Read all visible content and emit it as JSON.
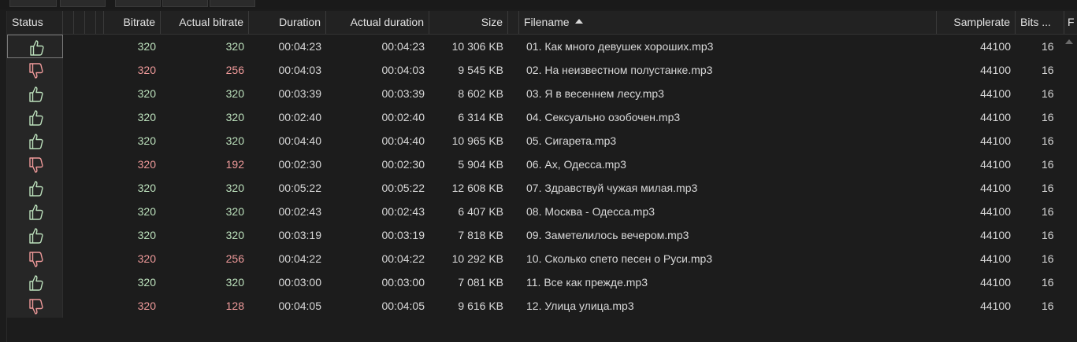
{
  "columns": {
    "status": "Status",
    "bitrate": "Bitrate",
    "actual_bitrate": "Actual bitrate",
    "duration": "Duration",
    "actual_duration": "Actual duration",
    "size": "Size",
    "filename": "Filename",
    "samplerate": "Samplerate",
    "bits": "Bits ...",
    "extra": "F"
  },
  "colors": {
    "good": "#bce0bc",
    "bad": "#ef9a9a"
  },
  "rows": [
    {
      "status": "good",
      "bitrate": "320",
      "actual_bitrate": "320",
      "duration": "00:04:23",
      "actual_duration": "00:04:23",
      "size": "10 306 KB",
      "filename": "01. Как много девушек хороших.mp3",
      "samplerate": "44100",
      "bits": "16"
    },
    {
      "status": "bad",
      "bitrate": "320",
      "actual_bitrate": "256",
      "duration": "00:04:03",
      "actual_duration": "00:04:03",
      "size": "9 545 KB",
      "filename": "02. На неизвестном полустанке.mp3",
      "samplerate": "44100",
      "bits": "16"
    },
    {
      "status": "good",
      "bitrate": "320",
      "actual_bitrate": "320",
      "duration": "00:03:39",
      "actual_duration": "00:03:39",
      "size": "8 602 KB",
      "filename": "03. Я в весеннем лесу.mp3",
      "samplerate": "44100",
      "bits": "16"
    },
    {
      "status": "good",
      "bitrate": "320",
      "actual_bitrate": "320",
      "duration": "00:02:40",
      "actual_duration": "00:02:40",
      "size": "6 314 KB",
      "filename": "04. Сексуально озобочен.mp3",
      "samplerate": "44100",
      "bits": "16"
    },
    {
      "status": "good",
      "bitrate": "320",
      "actual_bitrate": "320",
      "duration": "00:04:40",
      "actual_duration": "00:04:40",
      "size": "10 965 KB",
      "filename": "05. Сигарета.mp3",
      "samplerate": "44100",
      "bits": "16"
    },
    {
      "status": "bad",
      "bitrate": "320",
      "actual_bitrate": "192",
      "duration": "00:02:30",
      "actual_duration": "00:02:30",
      "size": "5 904 KB",
      "filename": "06. Ах, Одесса.mp3",
      "samplerate": "44100",
      "bits": "16"
    },
    {
      "status": "good",
      "bitrate": "320",
      "actual_bitrate": "320",
      "duration": "00:05:22",
      "actual_duration": "00:05:22",
      "size": "12 608 KB",
      "filename": "07. Здравствуй чужая милая.mp3",
      "samplerate": "44100",
      "bits": "16"
    },
    {
      "status": "good",
      "bitrate": "320",
      "actual_bitrate": "320",
      "duration": "00:02:43",
      "actual_duration": "00:02:43",
      "size": "6 407 KB",
      "filename": "08. Москва - Одесса.mp3",
      "samplerate": "44100",
      "bits": "16"
    },
    {
      "status": "good",
      "bitrate": "320",
      "actual_bitrate": "320",
      "duration": "00:03:19",
      "actual_duration": "00:03:19",
      "size": "7 818 KB",
      "filename": "09. Заметелилось вечером.mp3",
      "samplerate": "44100",
      "bits": "16"
    },
    {
      "status": "bad",
      "bitrate": "320",
      "actual_bitrate": "256",
      "duration": "00:04:22",
      "actual_duration": "00:04:22",
      "size": "10 292 KB",
      "filename": "10. Сколько спето песен о Руси.mp3",
      "samplerate": "44100",
      "bits": "16"
    },
    {
      "status": "good",
      "bitrate": "320",
      "actual_bitrate": "320",
      "duration": "00:03:00",
      "actual_duration": "00:03:00",
      "size": "7 081 KB",
      "filename": "11. Все как прежде.mp3",
      "samplerate": "44100",
      "bits": "16"
    },
    {
      "status": "bad",
      "bitrate": "320",
      "actual_bitrate": "128",
      "duration": "00:04:05",
      "actual_duration": "00:04:05",
      "size": "9 616 KB",
      "filename": "12. Улица улица.mp3",
      "samplerate": "44100",
      "bits": "16"
    }
  ]
}
